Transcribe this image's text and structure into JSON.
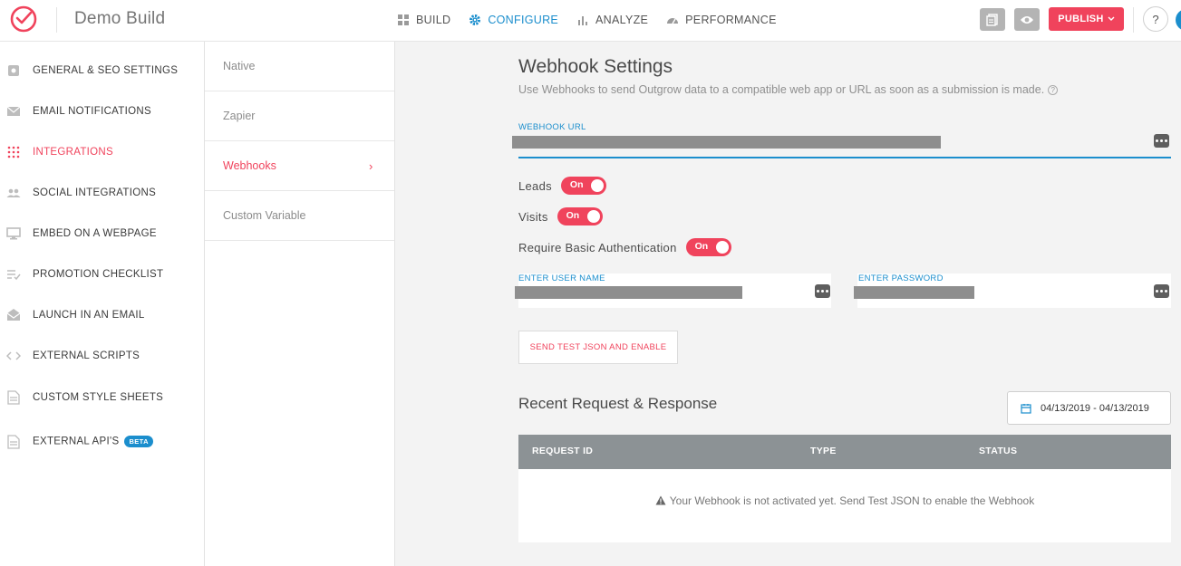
{
  "header": {
    "app_title": "Demo Build",
    "nav": [
      {
        "label": "BUILD",
        "icon": "grid-icon"
      },
      {
        "label": "CONFIGURE",
        "icon": "gear-icon"
      },
      {
        "label": "ANALYZE",
        "icon": "bar-chart-icon"
      },
      {
        "label": "PERFORMANCE",
        "icon": "gauge-icon"
      }
    ],
    "active_nav": "CONFIGURE",
    "publish_label": "PUBLISH",
    "help_label": "?",
    "colors": {
      "accent": "#1b8ecd",
      "brand": "#f0435c"
    }
  },
  "sidebar": {
    "items": [
      {
        "label": "GENERAL & SEO SETTINGS",
        "icon": "gear-icon"
      },
      {
        "label": "EMAIL NOTIFICATIONS",
        "icon": "envelope-icon"
      },
      {
        "label": "INTEGRATIONS",
        "icon": "dot-grid-icon",
        "active": true
      },
      {
        "label": "SOCIAL INTEGRATIONS",
        "icon": "people-icon"
      },
      {
        "label": "EMBED ON A WEBPAGE",
        "icon": "monitor-icon"
      },
      {
        "label": "PROMOTION CHECKLIST",
        "icon": "checklist-icon"
      },
      {
        "label": "LAUNCH IN AN EMAIL",
        "icon": "open-envelope-icon"
      },
      {
        "label": "EXTERNAL SCRIPTS",
        "icon": "code-icon"
      },
      {
        "label": "CUSTOM STYLE SHEETS",
        "icon": "css-file-icon"
      },
      {
        "label": "EXTERNAL API'S",
        "icon": "api-file-icon",
        "badge": "BETA"
      }
    ]
  },
  "subnav": {
    "items": [
      {
        "label": "Native"
      },
      {
        "label": "Zapier"
      },
      {
        "label": "Webhooks",
        "active": true
      },
      {
        "label": "Custom Variable"
      }
    ]
  },
  "main": {
    "title": "Webhook Settings",
    "subtitle": "Use Webhooks to send Outgrow data to a compatible web app or URL as soon as a submission is made.",
    "webhook_url_label": "WEBHOOK URL",
    "toggles": [
      {
        "label": "Leads",
        "state": "On"
      },
      {
        "label": "Visits",
        "state": "On"
      },
      {
        "label": "Require Basic Authentication",
        "state": "On"
      }
    ],
    "username_label": "ENTER USER NAME",
    "password_label": "ENTER PASSWORD",
    "send_button": "SEND TEST JSON AND ENABLE",
    "recent_title": "Recent Request & Response",
    "date_range": "04/13/2019 - 04/13/2019",
    "table": {
      "columns": [
        "REQUEST ID",
        "TYPE",
        "STATUS"
      ],
      "empty_message": "Your Webhook is not activated yet. Send Test JSON to enable the Webhook"
    }
  }
}
